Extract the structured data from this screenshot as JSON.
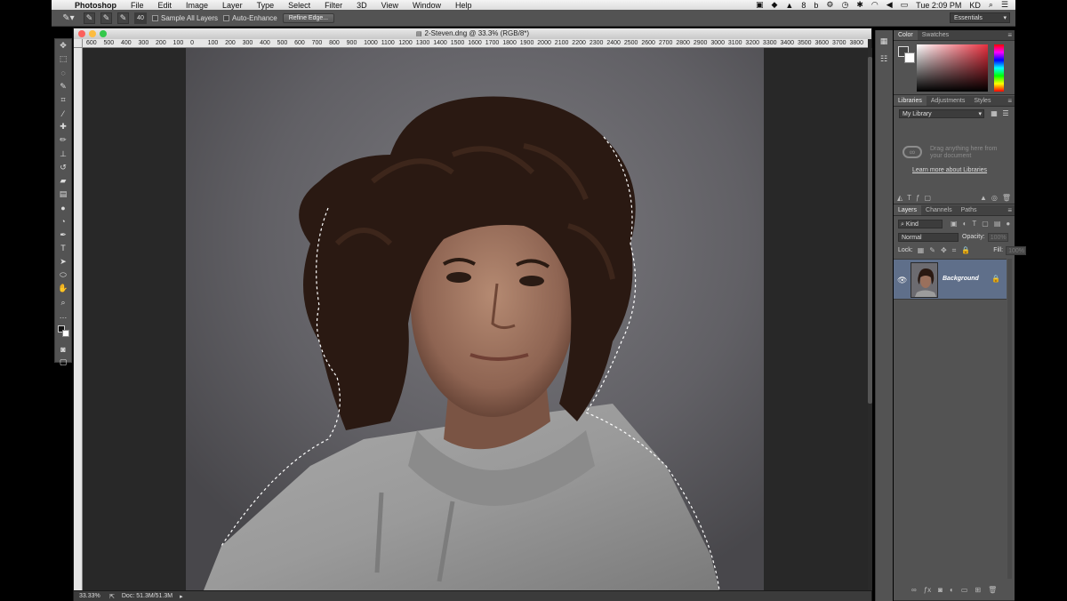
{
  "menubar": {
    "app_name": "Photoshop",
    "items": [
      "File",
      "Edit",
      "Image",
      "Layer",
      "Type",
      "Select",
      "Filter",
      "3D",
      "View",
      "Window",
      "Help"
    ],
    "status_icons": [
      "8"
    ],
    "clock": "Tue 2:09 PM",
    "user": "KD"
  },
  "options": {
    "brush_size": "40",
    "sample_all_layers": "Sample All Layers",
    "auto_enhance": "Auto-Enhance",
    "refine_edge": "Refine Edge...",
    "workspace": "Essentials"
  },
  "document": {
    "title": "2-Steven.dng @ 33.3% (RGB/8*)",
    "ruler_ticks": [
      "600",
      "500",
      "400",
      "300",
      "200",
      "100",
      "0",
      "100",
      "200",
      "300",
      "400",
      "500",
      "600",
      "700",
      "800",
      "900",
      "1000",
      "1100",
      "1200",
      "1300",
      "1400",
      "1500",
      "1600",
      "1700",
      "1800",
      "1900",
      "2000",
      "2100",
      "2200",
      "2300",
      "2400",
      "2500",
      "2600",
      "2700",
      "2800",
      "2900",
      "3000",
      "3100",
      "3200",
      "3300",
      "3400",
      "3500",
      "3600",
      "3700",
      "3800"
    ],
    "zoom": "33.33%",
    "doc_size": "Doc: 51.3M/51.3M"
  },
  "color_panel": {
    "tabs": [
      "Color",
      "Swatches"
    ],
    "accent": "#e8303f"
  },
  "libraries_panel": {
    "tabs": [
      "Libraries",
      "Adjustments",
      "Styles"
    ],
    "library": "My Library",
    "hint": "Drag anything here from your document",
    "link": "Learn more about Libraries"
  },
  "layers_panel": {
    "tabs": [
      "Layers",
      "Channels",
      "Paths"
    ],
    "filter_kind": "Kind",
    "blend_mode": "Normal",
    "opacity_label": "Opacity:",
    "opacity_value": "100%",
    "lock_label": "Lock:",
    "fill_label": "Fill:",
    "fill_value": "100%",
    "layers": [
      {
        "name": "Background",
        "visible": true,
        "locked": true,
        "selected": true
      }
    ],
    "selected_color": "#5f6f8a"
  }
}
